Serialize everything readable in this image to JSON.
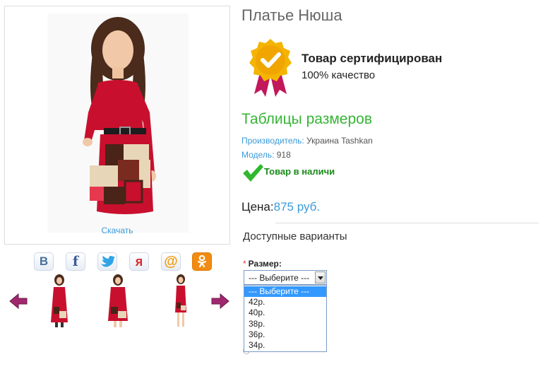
{
  "product": {
    "title": "Платье Нюша",
    "certificate_title": "Товар сертифицирован",
    "certificate_subtitle": "100% качество",
    "size_table_link": "Таблицы размеров",
    "manufacturer_label": "Производитель:",
    "manufacturer_value": " Украина Tashkan",
    "model_label": "Модель:",
    "model_value": " 918",
    "stock_text": "Товар в наличи",
    "price_label": "Цена:",
    "price_value": "875 руб.",
    "options_title": "Доступные варианты",
    "download_link": "Скачать"
  },
  "size_select": {
    "label": "Размер:",
    "required_mark": "*",
    "selected": "--- Выберите ---",
    "options": [
      "--- Выберите ---",
      "42р.",
      "40р.",
      "38р.",
      "36р.",
      "34р."
    ],
    "highlighted_index": 0
  },
  "share": [
    {
      "name": "vk",
      "glyph": "В",
      "color": "#4a6fa0"
    },
    {
      "name": "facebook",
      "glyph": "f",
      "color": "#3b5998"
    },
    {
      "name": "twitter",
      "glyph": "🐦",
      "color": "#2fa4e6"
    },
    {
      "name": "moikrug",
      "glyph": "ᴙ",
      "color": "#d52b2b"
    },
    {
      "name": "mailru",
      "glyph": "@",
      "color": "#f39c12"
    },
    {
      "name": "odnoklassniki",
      "glyph": "ок",
      "color": "#f28b11"
    }
  ],
  "colors": {
    "link": "#3a9ad9",
    "green": "#35b535",
    "dress_red": "#c8102e",
    "arrow": "#a0286e"
  }
}
